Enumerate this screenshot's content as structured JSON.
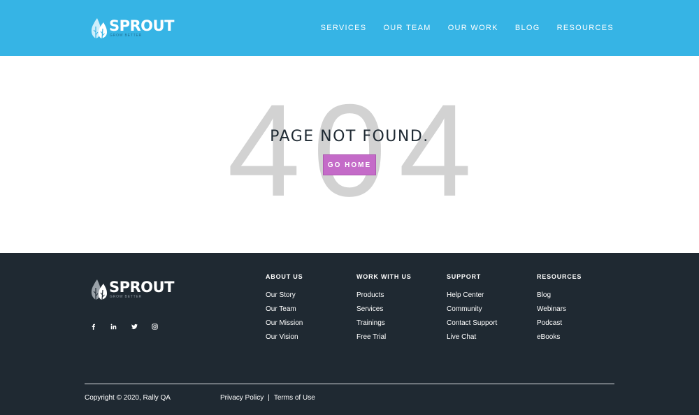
{
  "brand": {
    "name": "SPROUT",
    "tagline": "GROW BETTER"
  },
  "nav": [
    "SERVICES",
    "OUR TEAM",
    "OUR WORK",
    "BLOG",
    "RESOURCES"
  ],
  "error": {
    "code": "404",
    "title": "PAGE NOT FOUND.",
    "button": "GO HOME"
  },
  "footer": {
    "socials": [
      "facebook-icon",
      "linkedin-icon",
      "twitter-icon",
      "instagram-icon"
    ],
    "columns": [
      {
        "heading": "ABOUT US",
        "links": [
          "Our Story",
          "Our Team",
          "Our Mission",
          "Our Vision"
        ]
      },
      {
        "heading": "WORK WITH US",
        "links": [
          "Products",
          "Services",
          "Trainings",
          "Free Trial"
        ]
      },
      {
        "heading": "SUPPORT",
        "links": [
          "Help Center",
          "Community",
          "Contact Support",
          "Live Chat"
        ]
      },
      {
        "heading": "RESOURCES",
        "links": [
          "Blog",
          "Webinars",
          "Podcast",
          "eBooks"
        ]
      }
    ],
    "copyright": "Copyright © 2020, Rally QA",
    "privacy": "Privacy Policy",
    "separator": "|",
    "terms": "Terms of Use"
  },
  "colors": {
    "header_bg": "#36b4e5",
    "footer_bg": "#1f2932",
    "button_bg": "#c46bc8",
    "error_code": "#d2d2d2"
  }
}
